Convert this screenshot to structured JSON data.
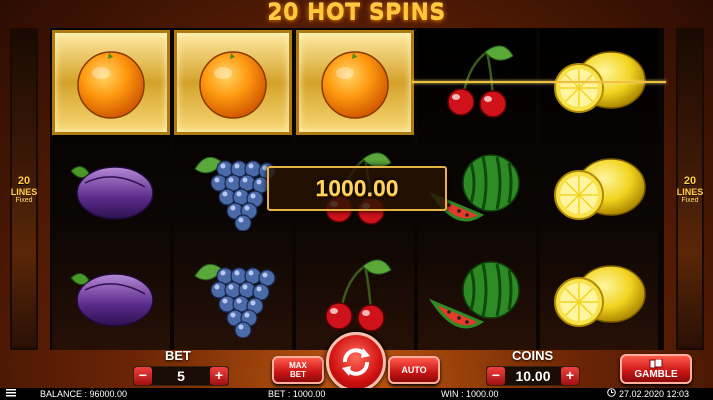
{
  "game": {
    "title": "20 HOT SPINS"
  },
  "lines": {
    "count": "20",
    "label": "LINES",
    "sub": "Fixed"
  },
  "win_amount": "1000.00",
  "reels": [
    [
      "orange",
      "plum",
      "plum"
    ],
    [
      "orange",
      "grapes",
      "grapes"
    ],
    [
      "orange",
      "cherries",
      "cherries"
    ],
    [
      "cherries",
      "watermelon",
      "watermelon"
    ],
    [
      "lemon",
      "lemon",
      "lemon"
    ]
  ],
  "winning_cells": [
    [
      0,
      0
    ],
    [
      1,
      0
    ],
    [
      2,
      0
    ]
  ],
  "controls": {
    "bet_label": "BET",
    "bet_value": "5",
    "coins_label": "COINS",
    "coins_value": "10.00",
    "minus": "−",
    "plus": "+",
    "max_bet_line1": "MAX",
    "max_bet_line2": "BET",
    "auto_label": "AUTO",
    "gamble_label": "GAMBLE"
  },
  "status": {
    "balance": "BALANCE : 96000.00",
    "bet": "BET : 1000.00",
    "win": "WIN : 1000.00",
    "datetime": "27.02.2020 12:03"
  },
  "icons": {
    "menu": "hamburger-icon",
    "spin": "spin-arrows-icon",
    "gamble": "cards-icon",
    "clock": "clock-icon"
  }
}
